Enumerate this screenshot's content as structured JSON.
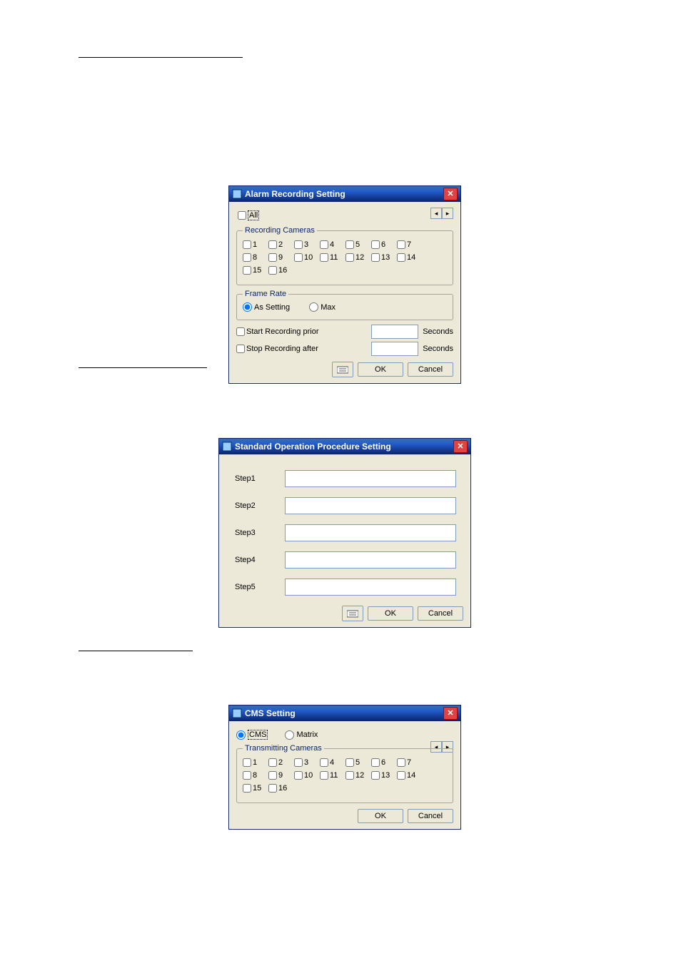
{
  "headings": {
    "h1": "",
    "h2": "",
    "h3": ""
  },
  "dialog1": {
    "title": "Alarm Recording Setting",
    "allLabel": "All",
    "recordingCamerasLegend": "Recording Cameras",
    "cameras": [
      "1",
      "2",
      "3",
      "4",
      "5",
      "6",
      "7",
      "8",
      "9",
      "10",
      "11",
      "12",
      "13",
      "14",
      "15",
      "16"
    ],
    "frameRateLegend": "Frame Rate",
    "asSetting": "As Setting",
    "max": "Max",
    "startRecordingPrior": "Start Recording prior",
    "stopRecordingAfter": "Stop Recording after",
    "seconds": "Seconds",
    "ok": "OK",
    "cancel": "Cancel"
  },
  "dialog2": {
    "title": "Standard Operation Procedure Setting",
    "steps": [
      "Step1",
      "Step2",
      "Step3",
      "Step4",
      "Step5"
    ],
    "ok": "OK",
    "cancel": "Cancel"
  },
  "dialog3": {
    "title": "CMS Setting",
    "cms": "CMS",
    "matrix": "Matrix",
    "transmittingCamerasLegend": "Transmitting Cameras",
    "cameras": [
      "1",
      "2",
      "3",
      "4",
      "5",
      "6",
      "7",
      "8",
      "9",
      "10",
      "11",
      "12",
      "13",
      "14",
      "15",
      "16"
    ],
    "ok": "OK",
    "cancel": "Cancel"
  }
}
